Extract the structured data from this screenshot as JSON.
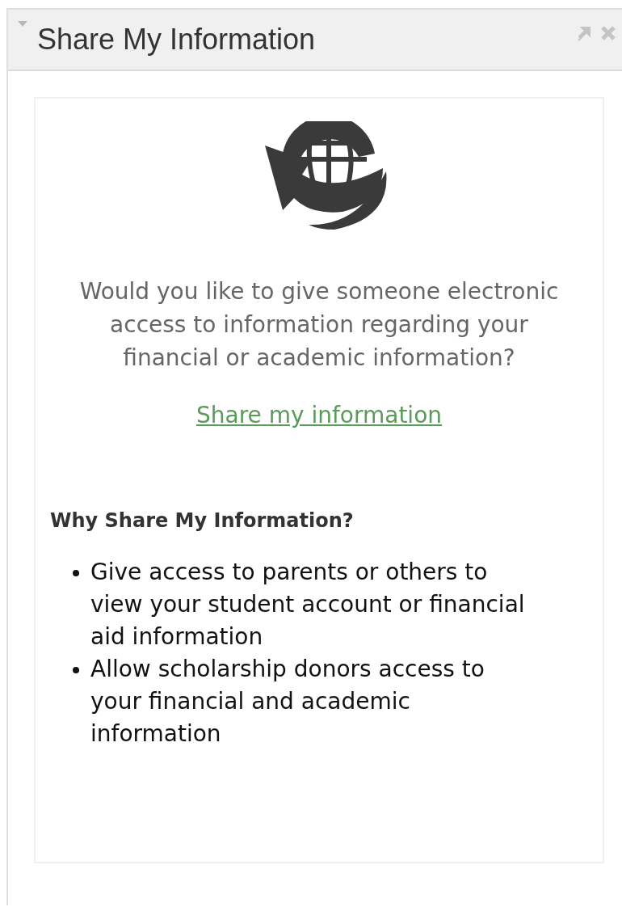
{
  "panel": {
    "title": "Share My Information"
  },
  "prompt": "Would you like to give someone electronic access to information regarding your financial or academic information?",
  "link": "Share my information",
  "why": {
    "heading": "Why Share My Information?",
    "items": [
      "Give access to parents or others to view your student account or financial aid information",
      "Allow scholarship donors access to your financial and academic information"
    ]
  }
}
